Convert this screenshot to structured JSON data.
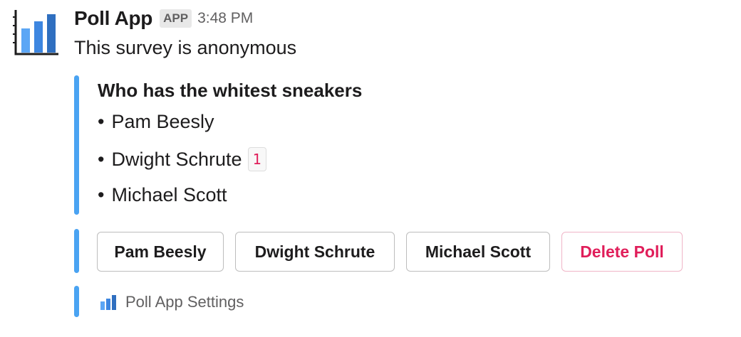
{
  "message": {
    "app_name": "Poll App",
    "badge": "APP",
    "timestamp": "3:48 PM",
    "text": "This survey is anonymous",
    "avatar_icon": "bar-chart-icon"
  },
  "poll": {
    "question": "Who has the whitest sneakers",
    "options": [
      {
        "bullet": "•",
        "label": "Pam Beesly",
        "votes": null
      },
      {
        "bullet": "•",
        "label": "Dwight Schrute",
        "votes": "1"
      },
      {
        "bullet": "•",
        "label": "Michael Scott",
        "votes": null
      }
    ]
  },
  "actions": {
    "buttons": [
      "Pam Beesly",
      "Dwight Schrute",
      "Michael Scott"
    ],
    "delete_label": "Delete Poll"
  },
  "footer": {
    "settings_label": "Poll App Settings",
    "settings_icon": "bar-chart-icon"
  },
  "colors": {
    "accent_bar": "#4aa3f2",
    "danger": "#e01e5a",
    "muted_text": "#616061"
  }
}
